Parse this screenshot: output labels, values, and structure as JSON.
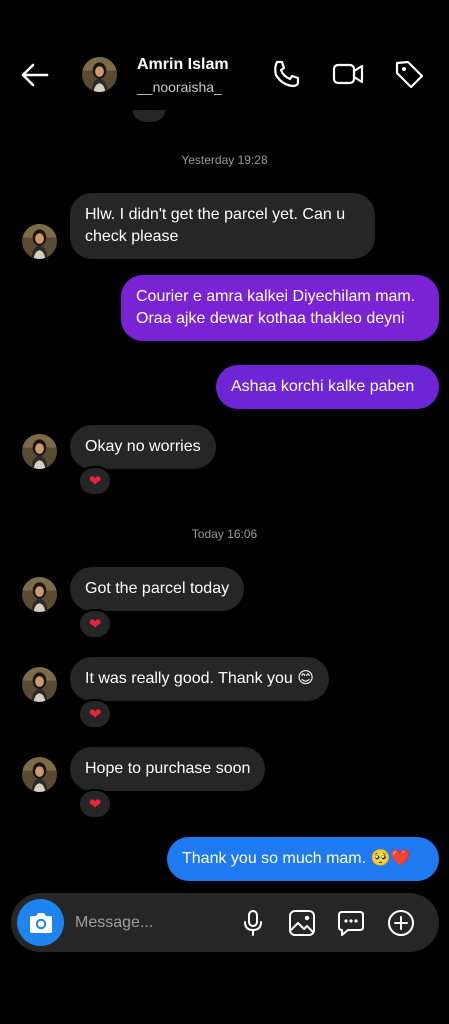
{
  "header": {
    "name": "Amrin Islam",
    "username": "__nooraisha_"
  },
  "timestamps": {
    "yesterday": "Yesterday 19:28",
    "today": "Today 16:06"
  },
  "messages": [
    {
      "text": "Hlw. I didn't get the parcel yet. Can u check please",
      "from": "them"
    },
    {
      "text": "Courier e amra kalkei Diyechilam mam. Oraa ajke dewar kothaa thakleo deyni",
      "from": "me"
    },
    {
      "text": "Ashaa korchi kalke paben",
      "from": "me"
    },
    {
      "text": "Okay no worries",
      "from": "them",
      "reaction": "❤"
    },
    {
      "text": "Got the parcel today",
      "from": "them",
      "reaction": "❤"
    },
    {
      "text": "It was really good. Thank you 😊",
      "from": "them",
      "reaction": "❤"
    },
    {
      "text": "Hope to purchase soon",
      "from": "them",
      "reaction": "❤"
    },
    {
      "text": "Thank you so much mam. 🥺❤️",
      "from": "me"
    }
  ],
  "composer": {
    "placeholder": "Message..."
  },
  "colors": {
    "background": "#000000",
    "incoming_bubble": "#262626",
    "outgoing_purple": "#7a23d4",
    "outgoing_blue": "#1f7af1",
    "heart": "#e8223a",
    "camera_button": "#1e84f0"
  },
  "icons": [
    "back-arrow-icon",
    "phone-icon",
    "video-icon",
    "tag-icon",
    "camera-icon",
    "microphone-icon",
    "gallery-icon",
    "sticker-icon",
    "plus-icon"
  ]
}
